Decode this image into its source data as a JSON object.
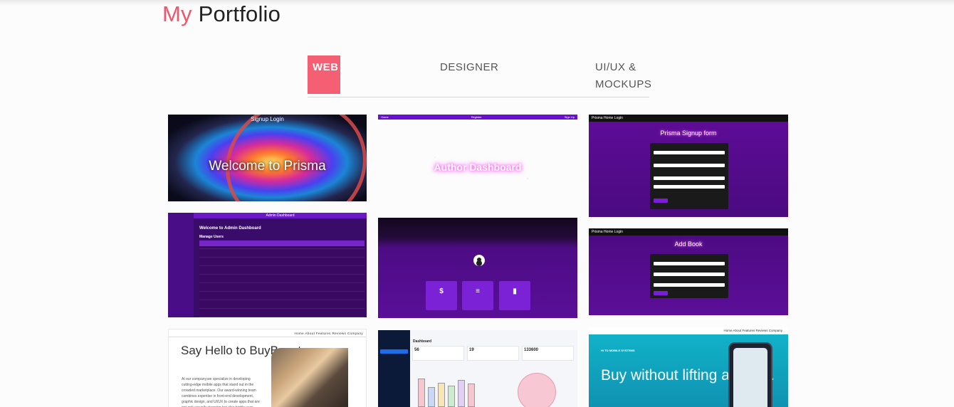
{
  "header": {
    "title_accent": "My",
    "title_rest": "Portfolio"
  },
  "tabs": [
    {
      "label": "WEB",
      "active": true
    },
    {
      "label": "DESIGNER",
      "active": false
    },
    {
      "label": "UI/UX & MOCKUPS",
      "active": false
    }
  ],
  "colors": {
    "accent": "#f55f73",
    "heading_accent": "#f0576c"
  },
  "cards": {
    "prisma": {
      "nav": "Signup  Login",
      "title": "Welcome to Prisma"
    },
    "author": {
      "nav_left": "Home",
      "nav_mid": "Register",
      "nav_right": "Sign Up",
      "title": "Author Dashboard"
    },
    "signup": {
      "nav": "Prisma   Home   Login",
      "title": "Prisma Signup form"
    },
    "admin": {
      "header": "Admin Dashboard",
      "welcome": "Welcome to Admin Dashboard",
      "manage": "Manage Users"
    },
    "reader": {
      "tiles": [
        "$",
        "≡",
        "▮"
      ]
    },
    "addbook": {
      "nav": "Prisma   Home   Login",
      "title": "Add Book"
    },
    "buybooster": {
      "nav": "Home   About   Features   Reviews   Company",
      "title": "Say Hello to BuyBooster",
      "text": "At our company,we specialize in developing cutting-edge mobile apps that stand out in the crowded marketplace. Our award-winning team combines expertise in front-end development, graphic design, and UI/UX to create apps that are not only visually stunning but also highly user-"
    },
    "dashboard": {
      "title": "Dashboard",
      "stats": [
        "56",
        "19",
        "133600"
      ]
    },
    "mobile": {
      "nav": "Home   About   Features   Reviews   Company",
      "logo": "HI TO MOBILE SYSTEMS",
      "title": "Buy without lifting a finger."
    }
  }
}
